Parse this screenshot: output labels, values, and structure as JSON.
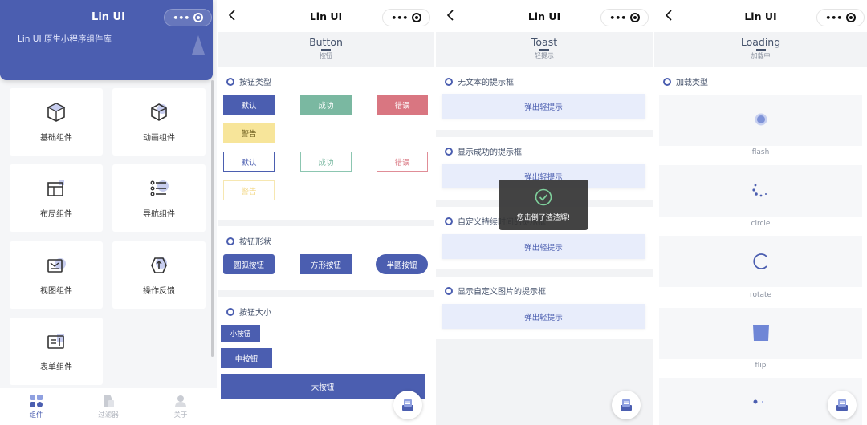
{
  "screen1": {
    "title": "Lin UI",
    "subtitle": "Lin UI 原生小程序组件库",
    "cards": [
      {
        "label": "基础组件",
        "icon": "cube-icon"
      },
      {
        "label": "动画组件",
        "icon": "cube-outline-icon"
      },
      {
        "label": "布局组件",
        "icon": "layout-icon"
      },
      {
        "label": "导航组件",
        "icon": "list-icon"
      },
      {
        "label": "视图组件",
        "icon": "view-icon"
      },
      {
        "label": "操作反馈",
        "icon": "feedback-icon"
      },
      {
        "label": "表单组件",
        "icon": "form-icon"
      }
    ],
    "tabs": [
      {
        "label": "组件",
        "active": true
      },
      {
        "label": "过滤器",
        "active": false
      },
      {
        "label": "关于",
        "active": false
      }
    ]
  },
  "screen2": {
    "nav_title": "Lin UI",
    "head_en": "Button",
    "head_zh": "按钮",
    "sections": {
      "types": "按钮类型",
      "shapes": "按钮形状",
      "sizes": "按钮大小"
    },
    "buttons": {
      "default": "默认",
      "success": "成功",
      "error": "错误",
      "warning": "警告",
      "round": "圆弧按钮",
      "square": "方形按钮",
      "semicircle": "半圆按钮",
      "small": "小按钮",
      "medium": "中按钮",
      "large": "大按钮"
    }
  },
  "screen3": {
    "nav_title": "Lin UI",
    "head_en": "Toast",
    "head_zh": "轻提示",
    "sections": [
      "无文本的提示框",
      "显示成功的提示框",
      "自定义持续时间的提示框",
      "显示自定义图片的提示框"
    ],
    "button_label": "弹出轻提示",
    "toast_message": "您击倒了渣渣辉!"
  },
  "screen4": {
    "nav_title": "Lin UI",
    "head_en": "Loading",
    "head_zh": "加载中",
    "section": "加载类型",
    "items": [
      "flash",
      "circle",
      "rotate",
      "flip"
    ]
  },
  "colors": {
    "primary": "#4b5eb0",
    "success": "#7ab8a1",
    "error": "#d97681",
    "warning": "#f7e59a"
  }
}
